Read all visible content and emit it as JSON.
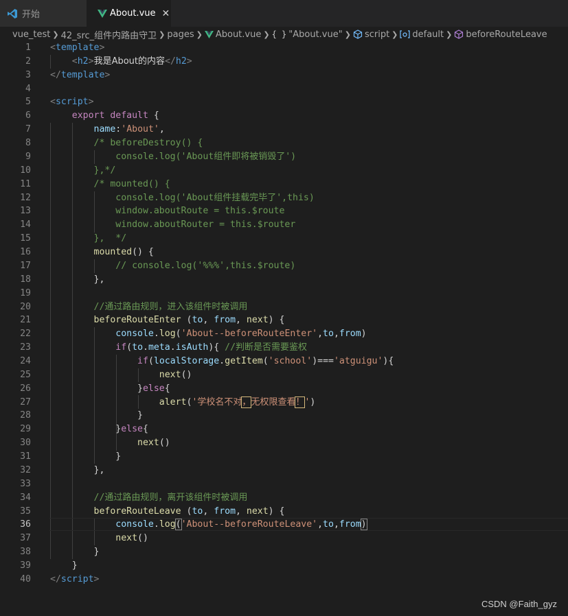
{
  "tabs": [
    {
      "label": "开始",
      "icon": "vscode-icon"
    },
    {
      "label": "About.vue",
      "icon": "vue-icon",
      "close": "✕"
    }
  ],
  "breadcrumb": [
    "vue_test",
    "42_src_组件内路由守卫",
    "pages",
    "About.vue",
    "\"About.vue\"",
    "script",
    "default",
    "beforeRouteLeave"
  ],
  "editor": {
    "current_line": 36
  },
  "watermark": "CSDN @Faith_gyz",
  "colors": {
    "accent_vue": "#41b883",
    "vscode_blue": "#3c99d4"
  }
}
